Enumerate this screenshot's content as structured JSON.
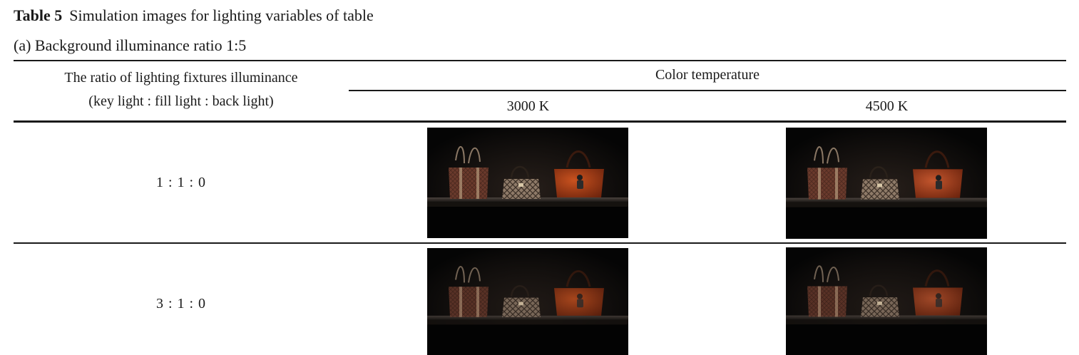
{
  "caption": {
    "label": "Table 5",
    "title": "Simulation images for lighting variables of table"
  },
  "subcaption": "(a) Background illuminance ratio 1:5",
  "header": {
    "ratio_line1": "The ratio of lighting fixtures illuminance",
    "ratio_line2": "(key light : fill light : back light)",
    "color_temperature": "Color temperature",
    "columns": [
      "3000 K",
      "4500 K"
    ]
  },
  "rows": [
    {
      "ratio": "1 : 1 : 0"
    },
    {
      "ratio": "3 : 1 : 0"
    }
  ],
  "colors": {
    "background": "#050505",
    "shelf": "#3a3431",
    "bag_brown": "#6a3a2c",
    "bag_check": "#8e7a68",
    "bag_orange": "#b7441e"
  }
}
